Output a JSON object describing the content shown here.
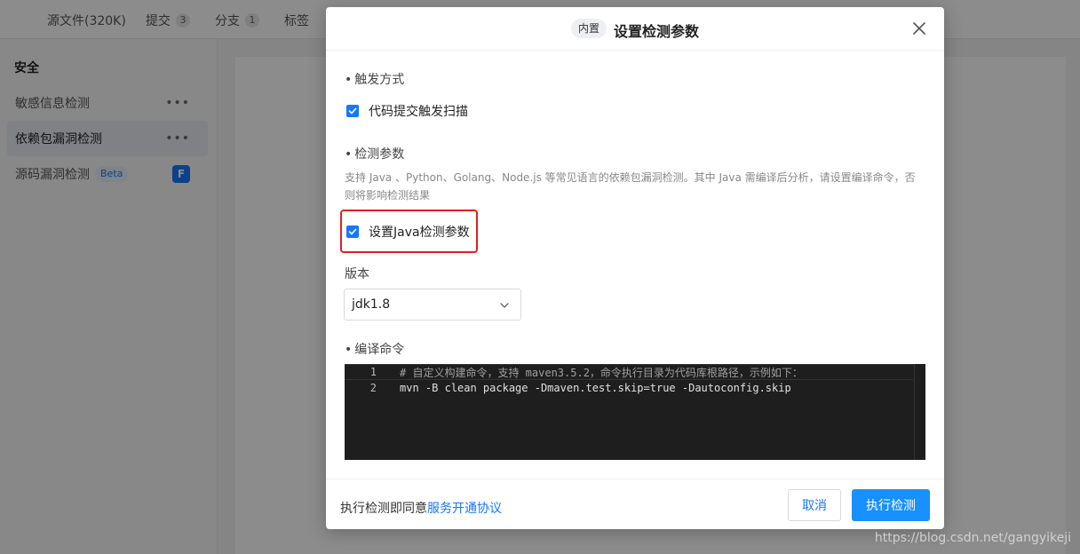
{
  "background": {
    "tabs": [
      {
        "label": "源文件(320K)",
        "count": ""
      },
      {
        "label": "提交",
        "count": "3"
      },
      {
        "label": "分支",
        "count": "1"
      },
      {
        "label": "标签",
        "count": ""
      }
    ],
    "sidebar": {
      "title": "安全",
      "items": [
        {
          "label": "敏感信息检测"
        },
        {
          "label": "依赖包漏洞检测"
        },
        {
          "label": "源码漏洞检测",
          "badge": "Beta"
        }
      ]
    }
  },
  "modal": {
    "badge": "内置",
    "title": "设置检测参数",
    "trigger": {
      "label": "触发方式",
      "checkbox_label": "代码提交触发扫描",
      "checked": true
    },
    "params": {
      "label": "检测参数",
      "description": "支持 Java 、Python、Golang、Node.js 等常见语言的依赖包漏洞检测。其中 Java 需编译后分析，请设置编译命令，否则将影响检测结果",
      "java_checkbox_label": "设置Java检测参数",
      "java_checked": true
    },
    "version": {
      "label": "版本",
      "selected": "jdk1.8"
    },
    "compile": {
      "label": "编译命令",
      "lines": [
        {
          "number": "1",
          "text": "# 自定义构建命令，支持 maven3.5.2，命令执行目录为代码库根路径，示例如下："
        },
        {
          "number": "2",
          "text": "mvn -B clean package -Dmaven.test.skip=true -Dautoconfig.skip"
        }
      ]
    },
    "footer": {
      "agree_prefix": "执行检测即同意",
      "agree_link": "服务开通协议",
      "cancel_label": "取消",
      "run_label": "执行检测"
    }
  },
  "watermark": "https://blog.csdn.net/gangyikeji",
  "colors": {
    "accent": "#1677ff",
    "highlight": "#e02020",
    "editor_bg": "#1e1e1e"
  }
}
